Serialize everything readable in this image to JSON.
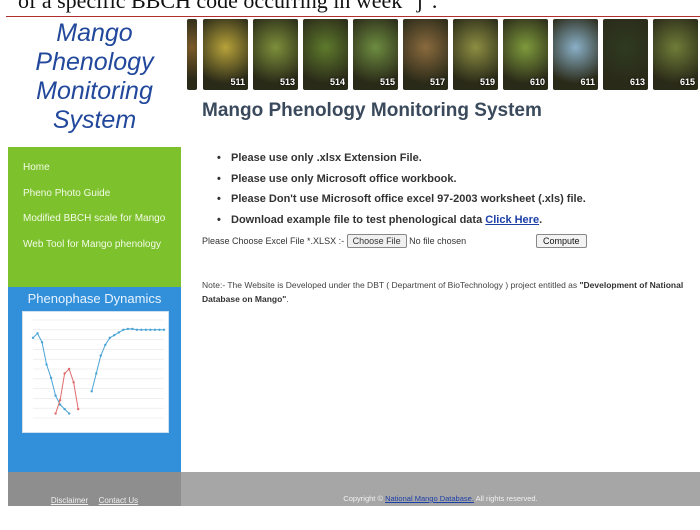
{
  "caption": {
    "text": "of a specific BBCH code occurring in week \"j\"."
  },
  "logo": {
    "line1": "Mango",
    "line2": "Phenology",
    "line3": "Monitoring",
    "line4": "System"
  },
  "nav": {
    "items": [
      "Home",
      "Pheno Photo Guide",
      "Modified BBCH scale for Mango",
      "Web Tool for Mango phenology"
    ]
  },
  "dynamics": {
    "title": "Phenophase Dynamics",
    "chart_data": {
      "type": "line",
      "title": "",
      "xlabel": "",
      "ylabel": "",
      "x": [
        1,
        2,
        3,
        4,
        5,
        6,
        7,
        8,
        9,
        10,
        11,
        12,
        13,
        14,
        15,
        16,
        17,
        18,
        19,
        20,
        21,
        22,
        23,
        24,
        25,
        26,
        27,
        28,
        29,
        30
      ],
      "series": [
        {
          "values": [
            90,
            95,
            85,
            60,
            45,
            25,
            15,
            10,
            5,
            null,
            null,
            null,
            null,
            null,
            null,
            null,
            null,
            null,
            null,
            null,
            null,
            null,
            null,
            null,
            null,
            null,
            null,
            null,
            null,
            null
          ],
          "color": "#4aa3d6"
        },
        {
          "values": [
            null,
            null,
            null,
            null,
            null,
            5,
            20,
            50,
            55,
            40,
            10,
            null,
            null,
            null,
            null,
            null,
            null,
            null,
            null,
            null,
            null,
            null,
            null,
            null,
            null,
            null,
            null,
            null,
            null,
            null
          ],
          "color": "#e06b6b"
        },
        {
          "values": [
            null,
            null,
            null,
            null,
            null,
            null,
            null,
            null,
            null,
            null,
            null,
            null,
            null,
            30,
            50,
            70,
            82,
            90,
            93,
            96,
            99,
            100,
            100,
            99,
            99,
            99,
            99,
            99,
            99,
            99
          ],
          "color": "#4aa3d6"
        }
      ],
      "ylim": [
        0,
        110
      ]
    }
  },
  "photos": {
    "items": [
      {
        "code": "",
        "color": "#7a5a2a"
      },
      {
        "code": "511",
        "color": "#b7a23a"
      },
      {
        "code": "513",
        "color": "#7c8f3a"
      },
      {
        "code": "514",
        "color": "#5e7a2c"
      },
      {
        "code": "515",
        "color": "#6d8c40"
      },
      {
        "code": "517",
        "color": "#8a6a3e"
      },
      {
        "code": "519",
        "color": "#8c8e42"
      },
      {
        "code": "610",
        "color": "#7e9a3c"
      },
      {
        "code": "611",
        "color": "#8ab0c8"
      },
      {
        "code": "613",
        "color": "#2e3a22"
      },
      {
        "code": "615",
        "color": "#6f7c38"
      }
    ]
  },
  "main": {
    "title": "Mango Phenology Monitoring System",
    "bullets": [
      "Please use only .xlsx Extension File.",
      "Please use only Microsoft office workbook.",
      "Please Don't use Microsoft office excel 97-2003 worksheet (.xls) file.",
      "Download example file to test phenological data "
    ],
    "download_link": "Click Here",
    "download_tail": ".",
    "file_label": "Please Choose Excel File *.XLSX :-",
    "choose_file": "Choose File",
    "no_file": "No file chosen",
    "compute": "Compute",
    "note_text": "Note:- The Website is Developed under the DBT ( Department of BioTechnology ) project entitled as ",
    "note_bold": "\"Development of National Database on Mango\"",
    "note_end": "."
  },
  "footer": {
    "disclaimer": "Disclaimer",
    "contact": "Contact Us",
    "copy_prefix": "Copyright © ",
    "copy_link": "National Mango Database.",
    "copy_suffix": " All rights reserved."
  }
}
